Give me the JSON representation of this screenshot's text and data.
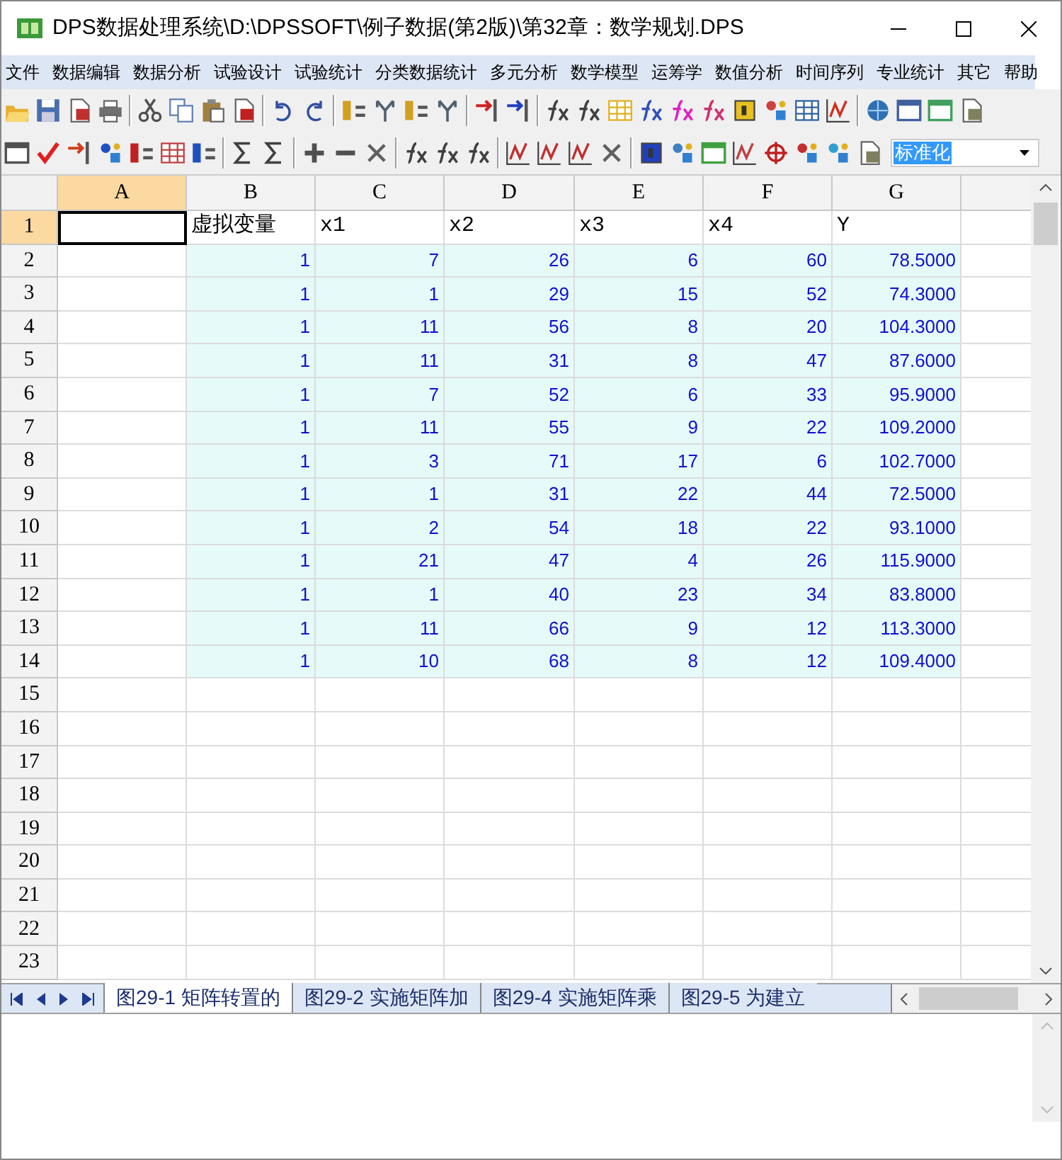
{
  "window": {
    "title": "DPS数据处理系统\\D:\\DPSSOFT\\例子数据(第2版)\\第32章：数学规划.DPS"
  },
  "menu": [
    "文件",
    "数据编辑",
    "数据分析",
    "试验设计",
    "试验统计",
    "分类数据统计",
    "多元分析",
    "数学模型",
    "运筹学",
    "数值分析",
    "时间序列",
    "专业统计",
    "其它",
    "帮助"
  ],
  "toolbar_combo": {
    "value": "标准化"
  },
  "sheet": {
    "columns": [
      {
        "label": "A",
        "selected": true
      },
      {
        "label": "B",
        "selected": false
      },
      {
        "label": "C",
        "selected": false
      },
      {
        "label": "D",
        "selected": false
      },
      {
        "label": "E",
        "selected": false
      },
      {
        "label": "F",
        "selected": false
      },
      {
        "label": "G",
        "selected": false
      }
    ],
    "rows": [
      {
        "label": "1",
        "selected": true,
        "kind": "text",
        "cells": [
          "虚拟变量",
          "x1",
          "x2",
          "x3",
          "x4",
          "Y"
        ]
      },
      {
        "label": "2",
        "selected": false,
        "kind": "data",
        "cells": [
          "1",
          "7",
          "26",
          "6",
          "60",
          "78.5000"
        ]
      },
      {
        "label": "3",
        "selected": false,
        "kind": "data",
        "cells": [
          "1",
          "1",
          "29",
          "15",
          "52",
          "74.3000"
        ]
      },
      {
        "label": "4",
        "selected": false,
        "kind": "data",
        "cells": [
          "1",
          "11",
          "56",
          "8",
          "20",
          "104.3000"
        ]
      },
      {
        "label": "5",
        "selected": false,
        "kind": "data",
        "cells": [
          "1",
          "11",
          "31",
          "8",
          "47",
          "87.6000"
        ]
      },
      {
        "label": "6",
        "selected": false,
        "kind": "data",
        "cells": [
          "1",
          "7",
          "52",
          "6",
          "33",
          "95.9000"
        ]
      },
      {
        "label": "7",
        "selected": false,
        "kind": "data",
        "cells": [
          "1",
          "11",
          "55",
          "9",
          "22",
          "109.2000"
        ]
      },
      {
        "label": "8",
        "selected": false,
        "kind": "data",
        "cells": [
          "1",
          "3",
          "71",
          "17",
          "6",
          "102.7000"
        ]
      },
      {
        "label": "9",
        "selected": false,
        "kind": "data",
        "cells": [
          "1",
          "1",
          "31",
          "22",
          "44",
          "72.5000"
        ]
      },
      {
        "label": "10",
        "selected": false,
        "kind": "data",
        "cells": [
          "1",
          "2",
          "54",
          "18",
          "22",
          "93.1000"
        ]
      },
      {
        "label": "11",
        "selected": false,
        "kind": "data",
        "cells": [
          "1",
          "21",
          "47",
          "4",
          "26",
          "115.9000"
        ]
      },
      {
        "label": "12",
        "selected": false,
        "kind": "data",
        "cells": [
          "1",
          "1",
          "40",
          "23",
          "34",
          "83.8000"
        ]
      },
      {
        "label": "13",
        "selected": false,
        "kind": "data",
        "cells": [
          "1",
          "11",
          "66",
          "9",
          "12",
          "113.3000"
        ]
      },
      {
        "label": "14",
        "selected": false,
        "kind": "data",
        "cells": [
          "1",
          "10",
          "68",
          "8",
          "12",
          "109.4000"
        ]
      },
      {
        "label": "15",
        "selected": false,
        "kind": "empty"
      },
      {
        "label": "16",
        "selected": false,
        "kind": "empty"
      },
      {
        "label": "17",
        "selected": false,
        "kind": "empty"
      },
      {
        "label": "18",
        "selected": false,
        "kind": "empty"
      },
      {
        "label": "19",
        "selected": false,
        "kind": "empty"
      },
      {
        "label": "20",
        "selected": false,
        "kind": "empty"
      },
      {
        "label": "21",
        "selected": false,
        "kind": "empty"
      },
      {
        "label": "22",
        "selected": false,
        "kind": "empty"
      },
      {
        "label": "23",
        "selected": false,
        "kind": "empty"
      }
    ]
  },
  "sheet_tabs": [
    {
      "label": "图29-1  矩阵转置的",
      "selected": true
    },
    {
      "label": "图29-2  实施矩阵加",
      "selected": false
    },
    {
      "label": "图29-4  实施矩阵乘",
      "selected": false
    },
    {
      "label": "图29-5  为建立",
      "selected": false
    }
  ]
}
